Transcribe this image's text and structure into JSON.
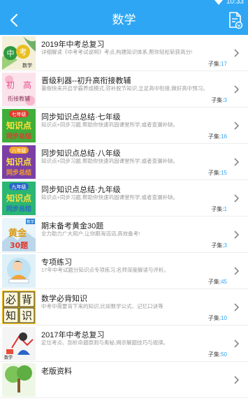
{
  "status": {
    "time": "10:33"
  },
  "header": {
    "title": "数学"
  },
  "count_prefix": "子集:",
  "items": [
    {
      "title": "2019年中考总复习",
      "desc": "详细解读《中考考试说明》考点,构建知识体系,帮你轻松斩获高分!",
      "count": "17",
      "thumb": {
        "line1": "中",
        "line2": "考",
        "tag": "数学"
      }
    },
    {
      "title": "晋级利器--初升高衔接教辅",
      "desc": "暑假快来开启学霸养成模式,弥补脱节知识,立足高中衔接,做好高中预习。",
      "count": "3",
      "thumb": {
        "line1": "初",
        "line2": "高",
        "line3": "衔接教辅"
      }
    },
    {
      "title": "同步知识点总结·七年级",
      "desc": "知识点+同步习题,帮助你快速巩固课堂所学,或者查漏补缺。",
      "count": "16",
      "thumb": {
        "grade": "七年级",
        "line1": "知识点",
        "line2": "同步总结"
      }
    },
    {
      "title": "同步知识点总结·八年级",
      "desc": "知识点+同步习题,帮助你快速巩固课堂所学,或者查漏补缺。",
      "count": "15",
      "thumb": {
        "grade": "八年级",
        "line1": "知识点",
        "line2": "同步总结"
      }
    },
    {
      "title": "同步知识点总结·九年级",
      "desc": "知识点+同步习题,帮助你快速巩固课堂所学,或者查漏补缺。",
      "count": "1",
      "thumb": {
        "grade": "九年级",
        "line1": "知识点",
        "line2": "同步总结"
      }
    },
    {
      "title": "期末备考黄金30题",
      "desc": "全力助力广大用户,让你跟海滔滔,高效备考!",
      "count": "3",
      "thumb": {
        "tag": "数学",
        "line1": "黄金",
        "line2": "30题"
      }
    },
    {
      "title": "专项练习",
      "desc": "17年中考试题分知识点专项练习,名师深度解读与评析。",
      "count": "45",
      "thumb": {}
    },
    {
      "title": "数学必背知识",
      "desc": "中考中需要背下来的知识,比如数学公式、记忆口诀等",
      "count": "10",
      "thumb": {
        "c1": "必",
        "c2": "背",
        "c3": "知",
        "c4": "识"
      }
    },
    {
      "title": "2017年中考总复习",
      "desc": "定位考点、剖析命题原则与奥秘,揭示解题技巧与规律。",
      "count": "50",
      "thumb": {
        "tag": "数学"
      }
    },
    {
      "title": "老版资料",
      "desc": "",
      "count": "",
      "thumb": {}
    }
  ],
  "colors": {
    "accent": "#2fa6f4",
    "count": "#2fa6f4"
  }
}
